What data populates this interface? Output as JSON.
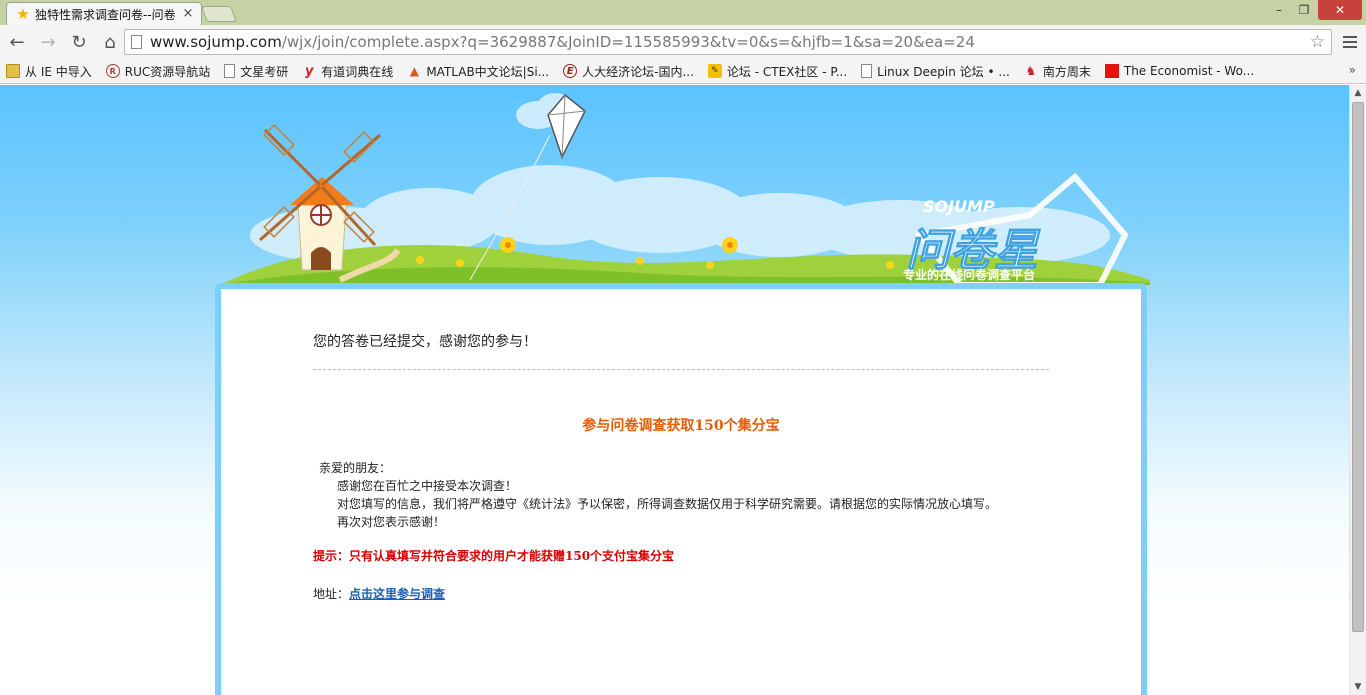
{
  "browser": {
    "tab": {
      "title": "独特性需求调查问卷--问卷",
      "favicon": "star-icon",
      "close": "×"
    },
    "window_controls": {
      "minimize": "–",
      "maximize": "❐",
      "close": "✕"
    },
    "address": {
      "host": "www.sojump.com",
      "path": "/wjx/join/complete.aspx?q=3629887&JoinID=115585993&tv=0&s=&hjfb=1&sa=20&ea=24"
    },
    "nav": {
      "back": "←",
      "forward": "→",
      "reload": "↻",
      "home": "⌂",
      "bookmark_star": "☆"
    }
  },
  "bookmarks": [
    {
      "label": "从 IE 中导入",
      "icon": "folder-icon"
    },
    {
      "label": "RUC资源导航站",
      "icon": "ruc-icon"
    },
    {
      "label": "文星考研",
      "icon": "page-icon"
    },
    {
      "label": "有道词典在线",
      "icon": "youdao-icon"
    },
    {
      "label": "MATLAB中文论坛|Si...",
      "icon": "matlab-icon"
    },
    {
      "label": "人大经济论坛-国内...",
      "icon": "pinggu-icon"
    },
    {
      "label": "论坛 - CTEX社区 - P...",
      "icon": "ctex-icon"
    },
    {
      "label": "Linux Deepin 论坛 • ...",
      "icon": "page-icon"
    },
    {
      "label": "南方周末",
      "icon": "nanfang-icon"
    },
    {
      "label": "The Economist - Wo...",
      "icon": "economist-icon"
    }
  ],
  "bookmarks_overflow": "»",
  "banner": {
    "brand_en": "SOJUMP",
    "brand_cn": "问卷星",
    "slogan": "专业的在线问卷调查平台"
  },
  "content": {
    "thanks": "您的答卷已经提交，感谢您的参与！",
    "promo_title": "参与问卷调查获取150个集分宝",
    "letter": {
      "greeting": "亲爱的朋友：",
      "line1": "感谢您在百忙之中接受本次调查！",
      "line2": "对您填写的信息，我们将严格遵守《统计法》予以保密，所得调查数据仅用于科学研究需要。请根据您的实际情况放心填写。",
      "line3": "再次对您表示感谢！"
    },
    "tip": "提示：只有认真填写并符合要求的用户才能获赠150个支付宝集分宝",
    "address_label": "地址：",
    "address_link": "点击这里参与调查"
  }
}
